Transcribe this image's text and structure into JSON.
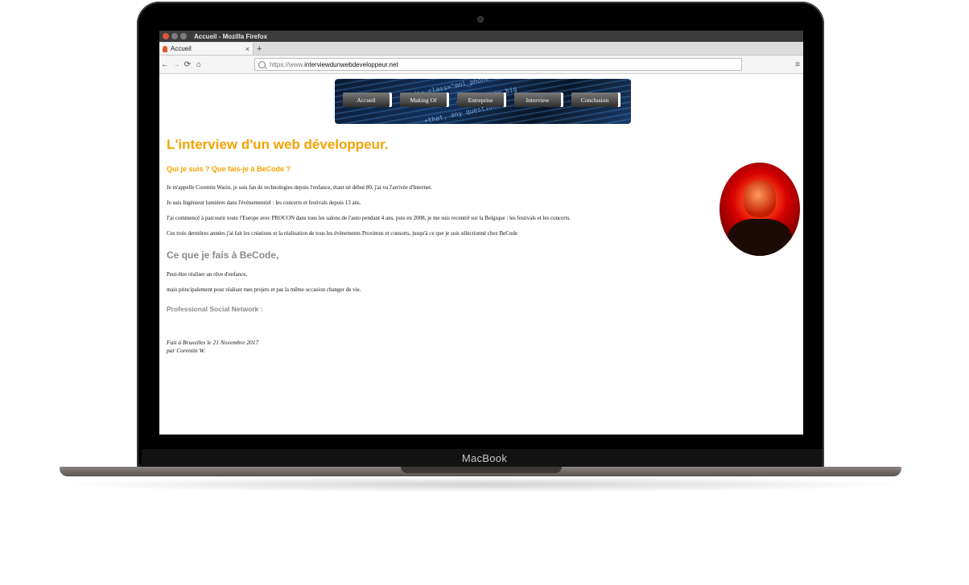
{
  "device": {
    "brand_label": "MacBook"
  },
  "window": {
    "title": "Accueil - Mozilla Firefox"
  },
  "tabs": [
    {
      "label": "Accueil",
      "close": "×"
    }
  ],
  "new_tab_symbol": "+",
  "navigation": {
    "back": "←",
    "forward": "→",
    "reload": "⟳",
    "home": "⌂",
    "url_scheme": "https://www.",
    "url_domain": "interviewdunwebdeveloppeur.net",
    "menu": "≡"
  },
  "site_menu": [
    "Accueil",
    "Making Of",
    "Entreprise",
    "Interview",
    "Conclusion"
  ],
  "banner_code": [
    "div class=\"mnl_phone\">",
    "<span class= big",
    "+that, any question."
  ],
  "page": {
    "title": "L'interview d'un web développeur.",
    "section1_heading": "Qui je suis ? Que fais-je à BeCode ?",
    "section1_paragraphs": [
      "Je m'appelle Corentin Warin, je suis fan de technologies depuis l'enfance, étant né début 80, j'ai vu l'arrivée d'Internet.",
      "Je suis Ingénieur lumières dans l'évènementiel : les concerts et festivals depuis 13 ans.",
      "J'ai commencé à parcourir toute l'Europe avec PROCON dans tous les salons de l'auto pendant 4 ans, puis en 2008, je me suis recentré sur la Belgique : les festivals et les concerts.",
      "Ces trois dernières années j'ai fait les créations et la réalisation de tous les évènements Proximus et consorts, jusqu'à ce que je sois sélectionné chez BeCode"
    ],
    "section2_heading": "Ce que je fais à BeCode,",
    "section2_paragraphs": [
      "Peut-être réaliser un rêve d'enfance,",
      "mais principalement pour réaliser mes projets et par la même occasion changer de vie."
    ],
    "social_heading": "Professional Social Network :",
    "footer": [
      "Fait à Bruxelles le 21 Novembre 2017",
      "par Corentin W."
    ]
  }
}
